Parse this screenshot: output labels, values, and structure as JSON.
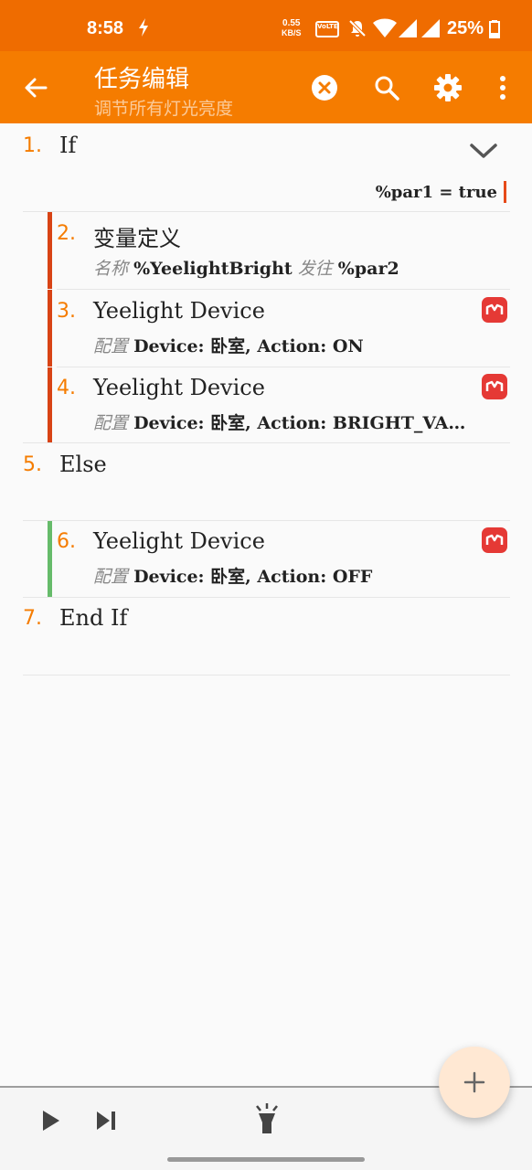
{
  "status_bar": {
    "time": "8:58",
    "net_speed_value": "0.55",
    "net_speed_unit": "KB/S",
    "volte": "VoLTE",
    "battery": "25%"
  },
  "app_bar": {
    "title": "任务编辑",
    "subtitle": "调节所有灯光亮度",
    "icons": [
      "back-arrow-icon",
      "clear-icon",
      "search-icon",
      "settings-icon",
      "more-vert-icon"
    ]
  },
  "actions": [
    {
      "num": "1.",
      "title": "If",
      "condition": "%par1 = true"
    },
    {
      "num": "2.",
      "title": "变量定义",
      "params": [
        {
          "label": "名称",
          "value": "%YeelightBright"
        },
        {
          "label": "发往",
          "value": "%par2"
        }
      ]
    },
    {
      "num": "3.",
      "title": "Yeelight Device",
      "params": [
        {
          "label": "配置",
          "value": "Device: 卧室, Action: ON"
        }
      ]
    },
    {
      "num": "4.",
      "title": "Yeelight Device",
      "params": [
        {
          "label": "配置",
          "value": "Device: 卧室, Action: BRIGHT_VA…"
        }
      ]
    },
    {
      "num": "5.",
      "title": "Else"
    },
    {
      "num": "6.",
      "title": "Yeelight Device",
      "params": [
        {
          "label": "配置",
          "value": "Device: 卧室, Action: OFF"
        }
      ]
    },
    {
      "num": "7.",
      "title": "End If"
    }
  ],
  "colors": {
    "statusbar": "#ef6c00",
    "appbar": "#f57c00",
    "if_branch": "#d84315",
    "else_branch": "#66bb6a",
    "plugin_icon": "#e53935"
  },
  "bottom_bar": {
    "icons": [
      "play-icon",
      "step-icon",
      "flashlight-icon"
    ]
  },
  "fab": {
    "icon": "add-icon"
  }
}
